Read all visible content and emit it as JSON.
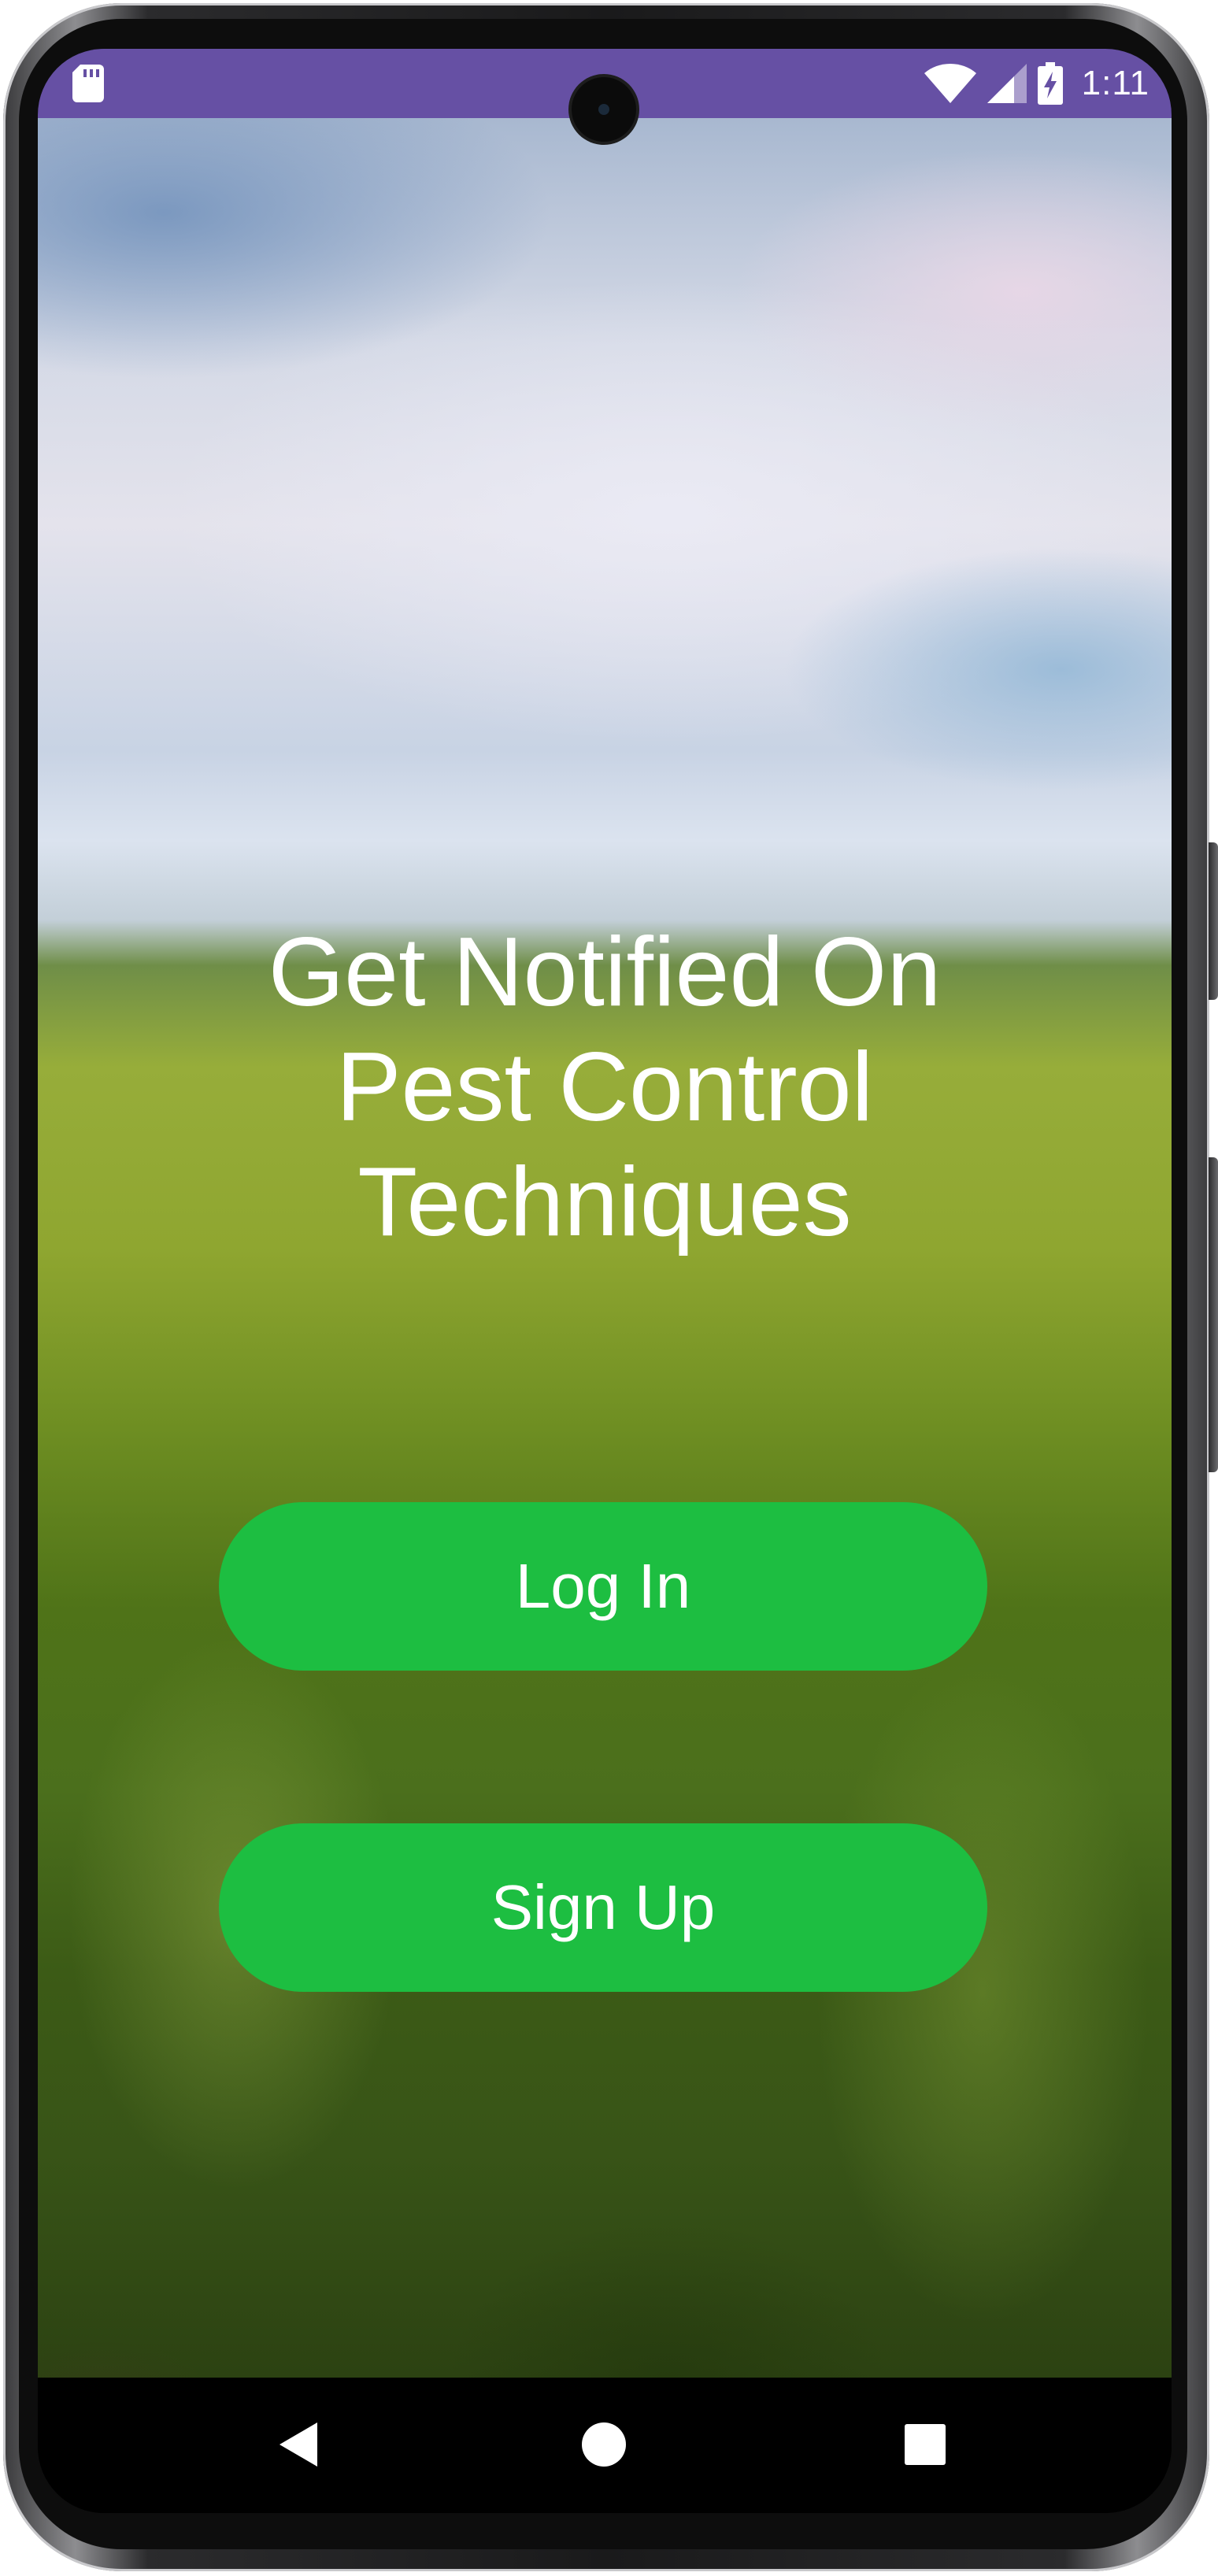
{
  "status_bar": {
    "time": "1:11",
    "left_icon": "sd-card-icon",
    "right_icons": [
      "wifi-icon",
      "cell-signal-icon",
      "battery-charging-icon"
    ],
    "background_color": "#6650a4"
  },
  "main": {
    "headline_lines": [
      "Get Notified On",
      "Pest Control",
      "Techniques"
    ],
    "login_label": "Log In",
    "signup_label": "Sign Up",
    "button_color": "#1dbe41",
    "text_color": "#ffffff"
  },
  "nav_bar": {
    "buttons": [
      "back-icon",
      "home-icon",
      "recents-icon"
    ]
  }
}
